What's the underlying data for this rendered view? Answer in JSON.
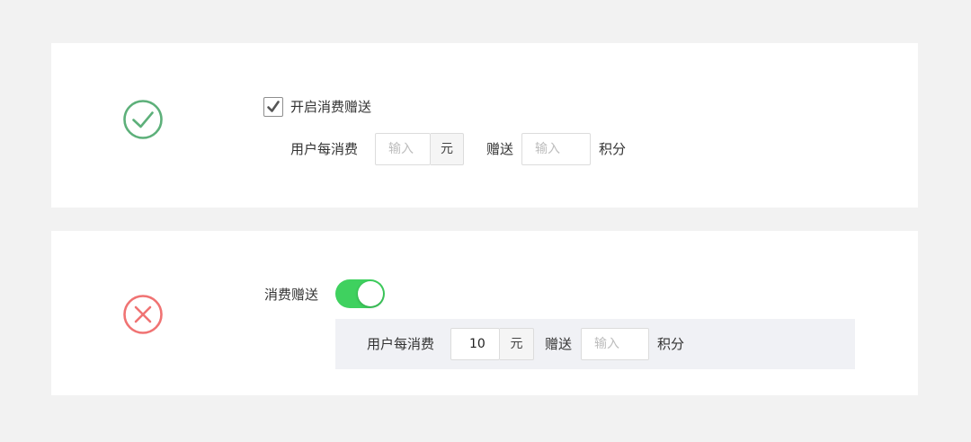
{
  "examples": {
    "good": {
      "checkbox_label": "开启消费赠送",
      "checked": true,
      "spend_label": "用户每消费",
      "spend_placeholder": "输入",
      "currency_unit": "元",
      "gift_label": "赠送",
      "gift_placeholder": "输入",
      "points_unit": "积分"
    },
    "bad": {
      "switch_label": "消费赠送",
      "switch_on": true,
      "spend_label": "用户每消费",
      "spend_value": "10",
      "currency_unit": "元",
      "gift_label": "赠送",
      "gift_placeholder": "输入",
      "points_unit": "积分"
    }
  },
  "icons": {
    "good": "check-circle-icon",
    "bad": "x-circle-icon",
    "checkbox": "checkmark-icon"
  },
  "colors": {
    "good": "#5db07a",
    "bad": "#f07373",
    "toggle_on": "#3fd15f",
    "background": "#f2f2f2",
    "panel": "#f0f1f5"
  }
}
